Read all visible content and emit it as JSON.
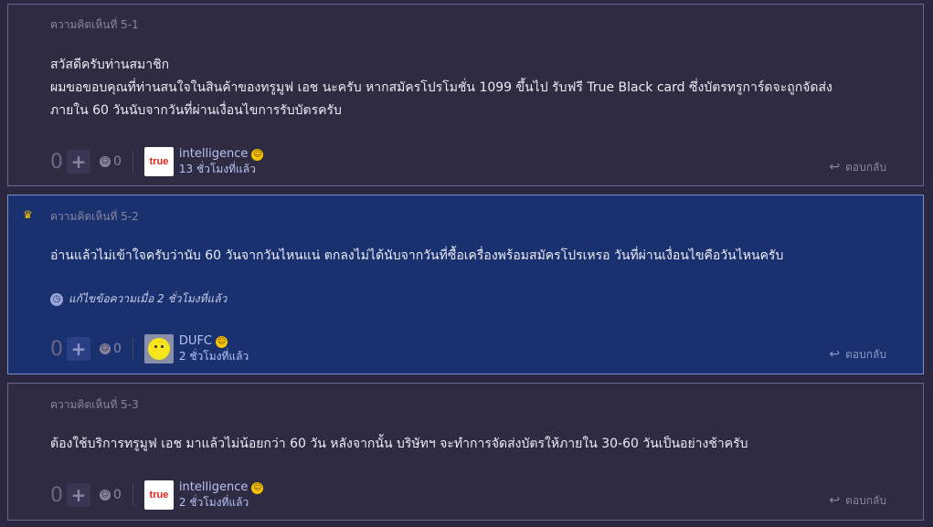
{
  "comments": [
    {
      "label": "ความคิดเห็นที่ 5-1",
      "body": [
        "สวัสดีครับท่านสมาชิก",
        "ผมขอขอบคุณที่ท่านสนใจในสินค้าของทรูมูฟ เอช นะครับ หากสมัครโปรโมชั่น 1099 ขึ้นไป รับฟรี True Black card ซึ่งบัตรทรูการ์ดจะถูกจัดส่ง",
        "ภายใน 60 วันนับจากวันที่ผ่านเงื่อนไขการรับบัตรครับ"
      ],
      "votes": "0",
      "emotions": "0",
      "user": "intelligence",
      "avatar_text": "true",
      "time": "13 ชั่วโมงที่แล้ว",
      "reply": "ตอบกลับ"
    },
    {
      "label": "ความคิดเห็นที่ 5-2",
      "body": [
        "อ่านแล้วไม่เข้าใจครับว่านับ 60 วันจากวันไหนแน่ ตกลงไม่ได้นับจากวันที่ซื้อเครื่องพร้อมสมัครโปรเหรอ วันที่ผ่านเงื่อนไขคือวันไหนครับ"
      ],
      "edit_note": "แก้ไขข้อความเมื่อ 2 ชั่วโมงที่แล้ว",
      "votes": "0",
      "emotions": "0",
      "user": "DUFC",
      "time": "2 ชั่วโมงที่แล้ว",
      "reply": "ตอบกลับ"
    },
    {
      "label": "ความคิดเห็นที่ 5-3",
      "body": [
        "ต้องใช้บริการทรูมูฟ เอช มาแล้วไม่น้อยกว่า 60 วัน หลังจากนั้น บริษัทฯ จะทำการจัดส่งบัตรให้ภายใน 30-60 วันเป็นอย่างช้าครับ"
      ],
      "votes": "0",
      "emotions": "0",
      "user": "intelligence",
      "avatar_text": "true",
      "time": "2 ชั่วโมงที่แล้ว",
      "reply": "ตอบกลับ"
    }
  ],
  "colors": {
    "page_bg": "#2b2740",
    "card_bg": "#2f2b42",
    "highlight_bg": "#1a3170",
    "link": "#b7c3f3"
  },
  "icons": {
    "vote": "plus-icon",
    "emotion": "emotion-face-icon",
    "reply": "reply-arrow-icon",
    "edit": "edit-clock-icon",
    "badge": "member-badge-icon",
    "pin": "owner-pin-icon"
  }
}
